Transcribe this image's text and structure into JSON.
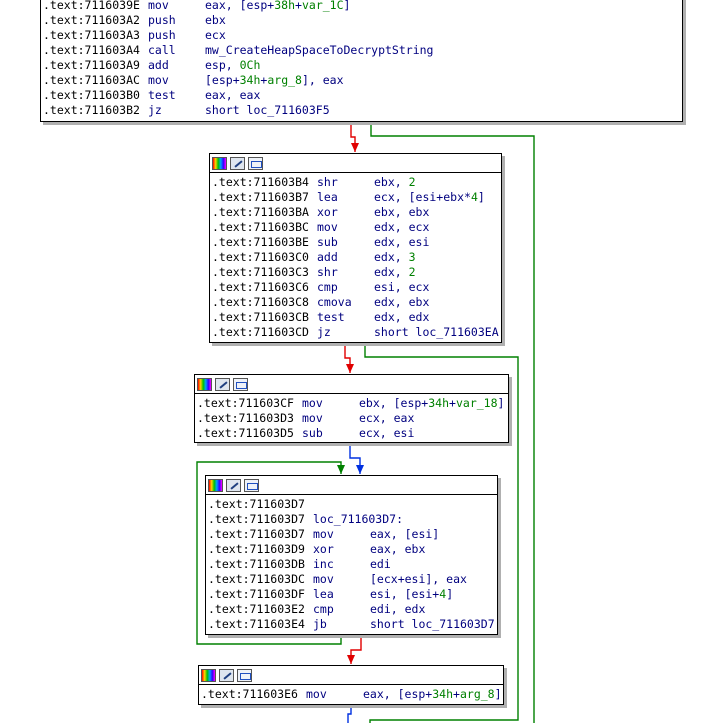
{
  "blocks": [
    {
      "id": "b0",
      "has_toolbar": false,
      "lines": [
        {
          "addr": ".text:7116039E",
          "mn": "mov",
          "ops": [
            {
              "t": "eax, [esp+"
            },
            {
              "t": "38h",
              "c": "num"
            },
            {
              "t": "+"
            },
            {
              "t": "var_1C",
              "c": "var"
            },
            {
              "t": "]"
            }
          ]
        },
        {
          "addr": ".text:711603A2",
          "mn": "push",
          "ops": [
            {
              "t": "ebx"
            }
          ]
        },
        {
          "addr": ".text:711603A3",
          "mn": "push",
          "ops": [
            {
              "t": "ecx"
            }
          ]
        },
        {
          "addr": ".text:711603A4",
          "mn": "call",
          "ops": [
            {
              "t": "mw_CreateHeapSpaceToDecryptString",
              "c": "fn"
            }
          ]
        },
        {
          "addr": ".text:711603A9",
          "mn": "add",
          "ops": [
            {
              "t": "esp, "
            },
            {
              "t": "0Ch",
              "c": "num"
            }
          ]
        },
        {
          "addr": ".text:711603AC",
          "mn": "mov",
          "ops": [
            {
              "t": "[esp+"
            },
            {
              "t": "34h",
              "c": "num"
            },
            {
              "t": "+"
            },
            {
              "t": "arg_8",
              "c": "var"
            },
            {
              "t": "], eax"
            }
          ]
        },
        {
          "addr": ".text:711603B0",
          "mn": "test",
          "ops": [
            {
              "t": "eax, eax"
            }
          ]
        },
        {
          "addr": ".text:711603B2",
          "mn": "jz",
          "ops": [
            {
              "t": "short loc_711603F5"
            }
          ]
        }
      ]
    },
    {
      "id": "b1",
      "has_toolbar": true,
      "lines": [
        {
          "addr": ".text:711603B4",
          "mn": "shr",
          "ops": [
            {
              "t": "ebx, "
            },
            {
              "t": "2",
              "c": "num"
            }
          ]
        },
        {
          "addr": ".text:711603B7",
          "mn": "lea",
          "ops": [
            {
              "t": "ecx, [esi+ebx*"
            },
            {
              "t": "4",
              "c": "num"
            },
            {
              "t": "]"
            }
          ]
        },
        {
          "addr": ".text:711603BA",
          "mn": "xor",
          "ops": [
            {
              "t": "ebx, ebx"
            }
          ]
        },
        {
          "addr": ".text:711603BC",
          "mn": "mov",
          "ops": [
            {
              "t": "edx, ecx"
            }
          ]
        },
        {
          "addr": ".text:711603BE",
          "mn": "sub",
          "ops": [
            {
              "t": "edx, esi"
            }
          ]
        },
        {
          "addr": ".text:711603C0",
          "mn": "add",
          "ops": [
            {
              "t": "edx, "
            },
            {
              "t": "3",
              "c": "num"
            }
          ]
        },
        {
          "addr": ".text:711603C3",
          "mn": "shr",
          "ops": [
            {
              "t": "edx, "
            },
            {
              "t": "2",
              "c": "num"
            }
          ]
        },
        {
          "addr": ".text:711603C6",
          "mn": "cmp",
          "ops": [
            {
              "t": "esi, ecx"
            }
          ]
        },
        {
          "addr": ".text:711603C8",
          "mn": "cmova",
          "ops": [
            {
              "t": "edx, ebx"
            }
          ]
        },
        {
          "addr": ".text:711603CB",
          "mn": "test",
          "ops": [
            {
              "t": "edx, edx"
            }
          ]
        },
        {
          "addr": ".text:711603CD",
          "mn": "jz",
          "ops": [
            {
              "t": "short loc_711603EA"
            }
          ]
        }
      ]
    },
    {
      "id": "b2",
      "has_toolbar": true,
      "lines": [
        {
          "addr": ".text:711603CF",
          "mn": "mov",
          "ops": [
            {
              "t": "ebx, [esp+"
            },
            {
              "t": "34h",
              "c": "num"
            },
            {
              "t": "+"
            },
            {
              "t": "var_18",
              "c": "var"
            },
            {
              "t": "]"
            }
          ]
        },
        {
          "addr": ".text:711603D3",
          "mn": "mov",
          "ops": [
            {
              "t": "ecx, eax"
            }
          ]
        },
        {
          "addr": ".text:711603D5",
          "mn": "sub",
          "ops": [
            {
              "t": "ecx, esi"
            }
          ]
        }
      ]
    },
    {
      "id": "b3",
      "has_toolbar": true,
      "lines": [
        {
          "addr": ".text:711603D7",
          "mn": "",
          "ops": []
        },
        {
          "addr": ".text:711603D7",
          "mn": "loc_711603D7:",
          "ops": [],
          "is_label": true
        },
        {
          "addr": ".text:711603D7",
          "mn": "mov",
          "ops": [
            {
              "t": "eax, [esi]"
            }
          ]
        },
        {
          "addr": ".text:711603D9",
          "mn": "xor",
          "ops": [
            {
              "t": "eax, ebx"
            }
          ]
        },
        {
          "addr": ".text:711603DB",
          "mn": "inc",
          "ops": [
            {
              "t": "edi"
            }
          ]
        },
        {
          "addr": ".text:711603DC",
          "mn": "mov",
          "ops": [
            {
              "t": "[ecx+esi], eax"
            }
          ]
        },
        {
          "addr": ".text:711603DF",
          "mn": "lea",
          "ops": [
            {
              "t": "esi, [esi+"
            },
            {
              "t": "4",
              "c": "num"
            },
            {
              "t": "]"
            }
          ]
        },
        {
          "addr": ".text:711603E2",
          "mn": "cmp",
          "ops": [
            {
              "t": "edi, edx"
            }
          ]
        },
        {
          "addr": ".text:711603E4",
          "mn": "jb",
          "ops": [
            {
              "t": "short loc_711603D7"
            }
          ]
        }
      ]
    },
    {
      "id": "b4",
      "has_toolbar": true,
      "lines": [
        {
          "addr": ".text:711603E6",
          "mn": "mov",
          "ops": [
            {
              "t": "eax, [esp+"
            },
            {
              "t": "34h",
              "c": "num"
            },
            {
              "t": "+"
            },
            {
              "t": "arg_8",
              "c": "var"
            },
            {
              "t": "]"
            }
          ]
        }
      ]
    }
  ],
  "colors": {
    "edge_true": "#e00000",
    "edge_false": "#008000",
    "edge_uncond": "#0030e0",
    "operand_number": "#008000",
    "mnemonic": "#00007f"
  }
}
